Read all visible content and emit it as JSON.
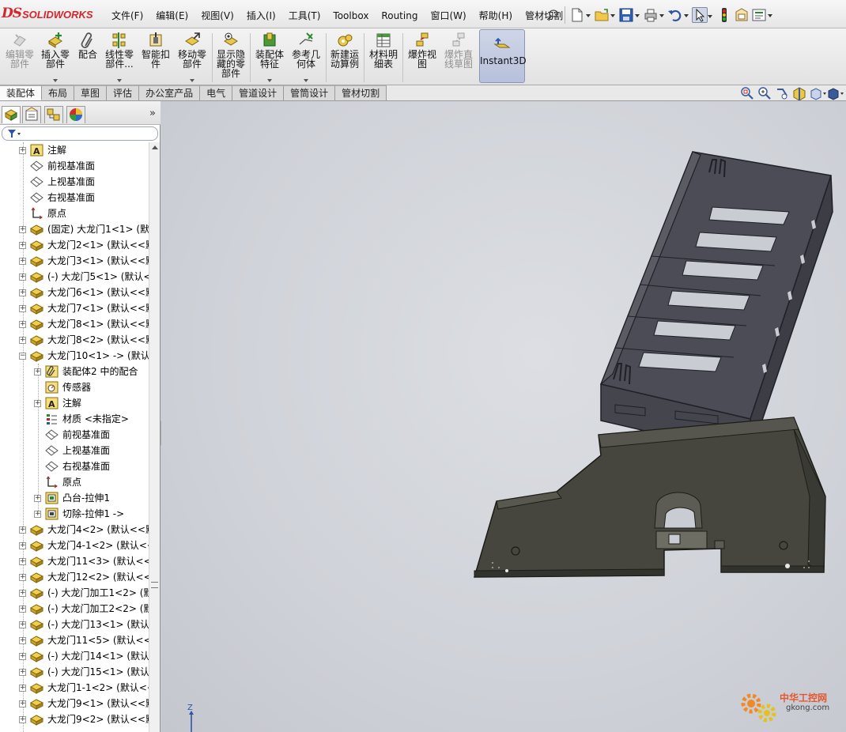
{
  "app": {
    "name": "SOLIDWORKS",
    "logo_mark": "DS"
  },
  "menubar": {
    "menus": [
      "文件(F)",
      "编辑(E)",
      "视图(V)",
      "插入(I)",
      "工具(T)",
      "Toolbox",
      "Routing",
      "窗口(W)",
      "帮助(H)",
      "管材切割"
    ],
    "quick_tools": [
      "pin-icon",
      "new-document-icon",
      "open-folder-icon",
      "save-icon",
      "print-icon",
      "undo-icon",
      "select-arrow-icon",
      "rebuild-traffic-light-icon",
      "file-properties-icon",
      "options-icon"
    ]
  },
  "command_manager": {
    "commands": [
      {
        "id": "edit-component",
        "label": "编辑零\n部件",
        "enabled": false,
        "dropdown": false
      },
      {
        "id": "insert-component",
        "label": "插入零\n部件",
        "enabled": true,
        "dropdown": true
      },
      {
        "id": "mate",
        "label": "配合",
        "enabled": true,
        "dropdown": false
      },
      {
        "id": "linear-pattern",
        "label": "线性零\n部件...",
        "enabled": true,
        "dropdown": true
      },
      {
        "id": "smart-fasteners",
        "label": "智能扣\n件",
        "enabled": true,
        "dropdown": false
      },
      {
        "id": "move-component",
        "label": "移动零\n部件",
        "enabled": true,
        "dropdown": true
      },
      {
        "id": "show-hidden",
        "label": "显示隐\n藏的零\n部件",
        "enabled": true,
        "dropdown": false
      },
      {
        "id": "assembly-features",
        "label": "装配体\n特征",
        "enabled": true,
        "dropdown": true
      },
      {
        "id": "reference-geometry",
        "label": "参考几\n何体",
        "enabled": true,
        "dropdown": true
      },
      {
        "id": "new-motion-study",
        "label": "新建运\n动算例",
        "enabled": true,
        "dropdown": false
      },
      {
        "id": "bill-of-materials",
        "label": "材料明\n细表",
        "enabled": true,
        "dropdown": false
      },
      {
        "id": "exploded-view",
        "label": "爆炸视\n图",
        "enabled": true,
        "dropdown": false
      },
      {
        "id": "explode-line-sketch",
        "label": "爆炸直\n线草图",
        "enabled": false,
        "dropdown": false
      },
      {
        "id": "instant3d",
        "label": "Instant3D",
        "enabled": true,
        "dropdown": false,
        "pressed": true
      }
    ]
  },
  "tabs": {
    "items": [
      "装配体",
      "布局",
      "草图",
      "评估",
      "办公室产品",
      "电气",
      "管道设计",
      "管筒设计",
      "管材切割"
    ],
    "active": 0
  },
  "view_tools": [
    "zoom-to-fit-icon",
    "zoom-to-area-icon",
    "previous-view-icon",
    "section-view-icon",
    "view-orientation-icon",
    "display-style-icon"
  ],
  "feature_manager": {
    "panel_tabs": [
      "featuremanager-tree-icon",
      "property-manager-icon",
      "configuration-manager-icon",
      "display-manager-icon"
    ],
    "collapse_glyph": "»",
    "filter_icon": "filter-icon",
    "tree": [
      {
        "level": 1,
        "toggle": "+",
        "icon": "annotation-icon",
        "text": "注解"
      },
      {
        "level": 1,
        "toggle": "",
        "icon": "plane-icon",
        "text": "前视基准面"
      },
      {
        "level": 1,
        "toggle": "",
        "icon": "plane-icon",
        "text": "上视基准面"
      },
      {
        "level": 1,
        "toggle": "",
        "icon": "plane-icon",
        "text": "右视基准面"
      },
      {
        "level": 1,
        "toggle": "",
        "icon": "origin-icon",
        "text": "原点"
      },
      {
        "level": 1,
        "toggle": "+",
        "icon": "part-icon",
        "text": "(固定) 大龙门1<1> (默认"
      },
      {
        "level": 1,
        "toggle": "+",
        "icon": "part-icon",
        "text": "大龙门2<1> (默认<<默"
      },
      {
        "level": 1,
        "toggle": "+",
        "icon": "part-icon",
        "text": "大龙门3<1> (默认<<默"
      },
      {
        "level": 1,
        "toggle": "+",
        "icon": "part-icon",
        "text": "(-) 大龙门5<1> (默认<"
      },
      {
        "level": 1,
        "toggle": "+",
        "icon": "part-icon",
        "text": "大龙门6<1> (默认<<默"
      },
      {
        "level": 1,
        "toggle": "+",
        "icon": "part-icon",
        "text": "大龙门7<1> (默认<<默"
      },
      {
        "level": 1,
        "toggle": "+",
        "icon": "part-icon",
        "text": "大龙门8<1> (默认<<默"
      },
      {
        "level": 1,
        "toggle": "+",
        "icon": "part-icon",
        "text": "大龙门8<2> (默认<<默"
      },
      {
        "level": 1,
        "toggle": "−",
        "icon": "part-icon",
        "text": "大龙门10<1> -> (默认"
      },
      {
        "level": 2,
        "toggle": "+",
        "icon": "mates-icon",
        "text": "装配体2 中的配合"
      },
      {
        "level": 2,
        "toggle": "",
        "icon": "sensor-icon",
        "text": "传感器"
      },
      {
        "level": 2,
        "toggle": "+",
        "icon": "annotation-icon",
        "text": "注解"
      },
      {
        "level": 2,
        "toggle": "",
        "icon": "material-icon",
        "text": "材质 <未指定>"
      },
      {
        "level": 2,
        "toggle": "",
        "icon": "plane-icon",
        "text": "前视基准面"
      },
      {
        "level": 2,
        "toggle": "",
        "icon": "plane-icon",
        "text": "上视基准面"
      },
      {
        "level": 2,
        "toggle": "",
        "icon": "plane-icon",
        "text": "右视基准面"
      },
      {
        "level": 2,
        "toggle": "",
        "icon": "origin-icon",
        "text": "原点"
      },
      {
        "level": 2,
        "toggle": "+",
        "icon": "extrude-boss-icon",
        "text": "凸台-拉伸1"
      },
      {
        "level": 2,
        "toggle": "+",
        "icon": "extrude-cut-icon",
        "text": "切除-拉伸1 ->"
      },
      {
        "level": 1,
        "toggle": "+",
        "icon": "part-icon",
        "text": "大龙门4<2> (默认<<默"
      },
      {
        "level": 1,
        "toggle": "+",
        "icon": "part-icon",
        "text": "大龙门4-1<2> (默认<<"
      },
      {
        "level": 1,
        "toggle": "+",
        "icon": "part-icon",
        "text": "大龙门11<3> (默认<<默"
      },
      {
        "level": 1,
        "toggle": "+",
        "icon": "part-icon",
        "text": "大龙门12<2> (默认<<默"
      },
      {
        "level": 1,
        "toggle": "+",
        "icon": "part-icon",
        "text": "(-) 大龙门加工1<2> (默"
      },
      {
        "level": 1,
        "toggle": "+",
        "icon": "part-icon",
        "text": "(-) 大龙门加工2<2> (默"
      },
      {
        "level": 1,
        "toggle": "+",
        "icon": "part-icon",
        "text": "(-) 大龙门13<1> (默认"
      },
      {
        "level": 1,
        "toggle": "+",
        "icon": "part-icon",
        "text": "大龙门11<5> (默认<<默"
      },
      {
        "level": 1,
        "toggle": "+",
        "icon": "part-icon",
        "text": "(-) 大龙门14<1> (默认"
      },
      {
        "level": 1,
        "toggle": "+",
        "icon": "part-icon",
        "text": "(-) 大龙门15<1> (默认"
      },
      {
        "level": 1,
        "toggle": "+",
        "icon": "part-icon",
        "text": "大龙门1-1<2> (默认<<"
      },
      {
        "level": 1,
        "toggle": "+",
        "icon": "part-icon",
        "text": "大龙门9<1> (默认<<默"
      },
      {
        "level": 1,
        "toggle": "+",
        "icon": "part-icon",
        "text": "大龙门9<2> (默认<<默"
      }
    ]
  },
  "viewport": {
    "triad_axis": "Z",
    "colors": {
      "sheet_metal_face": "#4a4a52",
      "sheet_metal_edge": "#22232a",
      "base_plate": "#45443e",
      "background": "#d3d6dc"
    },
    "watermark": {
      "line1": "中华工控网",
      "line2": "gkong.com",
      "icon": "gear-logo-icon"
    }
  }
}
